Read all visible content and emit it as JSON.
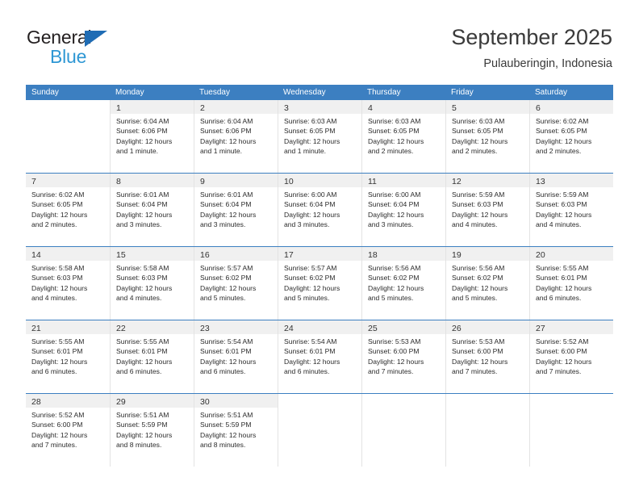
{
  "brand": {
    "name_part1": "General",
    "name_part2": "Blue",
    "triangle_icon": "brand-triangle-icon",
    "color_dark": "#231f20",
    "color_blue": "#2e97d4",
    "color_triangle": "#1f6cb4"
  },
  "header": {
    "title": "September 2025",
    "subtitle": "Pulauberingin, Indonesia"
  },
  "colors": {
    "header_row_bg": "#3c7fc1",
    "header_row_text": "#ffffff",
    "daynum_band_bg": "#f0f0f0",
    "cell_divider": "#e3e3e3",
    "week_divider": "#3c7fc1",
    "body_text": "#2b2b2b"
  },
  "weekdays": [
    "Sunday",
    "Monday",
    "Tuesday",
    "Wednesday",
    "Thursday",
    "Friday",
    "Saturday"
  ],
  "weeks": [
    [
      {
        "day": "",
        "lines": []
      },
      {
        "day": "1",
        "lines": [
          "Sunrise: 6:04 AM",
          "Sunset: 6:06 PM",
          "Daylight: 12 hours",
          "and 1 minute."
        ]
      },
      {
        "day": "2",
        "lines": [
          "Sunrise: 6:04 AM",
          "Sunset: 6:06 PM",
          "Daylight: 12 hours",
          "and 1 minute."
        ]
      },
      {
        "day": "3",
        "lines": [
          "Sunrise: 6:03 AM",
          "Sunset: 6:05 PM",
          "Daylight: 12 hours",
          "and 1 minute."
        ]
      },
      {
        "day": "4",
        "lines": [
          "Sunrise: 6:03 AM",
          "Sunset: 6:05 PM",
          "Daylight: 12 hours",
          "and 2 minutes."
        ]
      },
      {
        "day": "5",
        "lines": [
          "Sunrise: 6:03 AM",
          "Sunset: 6:05 PM",
          "Daylight: 12 hours",
          "and 2 minutes."
        ]
      },
      {
        "day": "6",
        "lines": [
          "Sunrise: 6:02 AM",
          "Sunset: 6:05 PM",
          "Daylight: 12 hours",
          "and 2 minutes."
        ]
      }
    ],
    [
      {
        "day": "7",
        "lines": [
          "Sunrise: 6:02 AM",
          "Sunset: 6:05 PM",
          "Daylight: 12 hours",
          "and 2 minutes."
        ]
      },
      {
        "day": "8",
        "lines": [
          "Sunrise: 6:01 AM",
          "Sunset: 6:04 PM",
          "Daylight: 12 hours",
          "and 3 minutes."
        ]
      },
      {
        "day": "9",
        "lines": [
          "Sunrise: 6:01 AM",
          "Sunset: 6:04 PM",
          "Daylight: 12 hours",
          "and 3 minutes."
        ]
      },
      {
        "day": "10",
        "lines": [
          "Sunrise: 6:00 AM",
          "Sunset: 6:04 PM",
          "Daylight: 12 hours",
          "and 3 minutes."
        ]
      },
      {
        "day": "11",
        "lines": [
          "Sunrise: 6:00 AM",
          "Sunset: 6:04 PM",
          "Daylight: 12 hours",
          "and 3 minutes."
        ]
      },
      {
        "day": "12",
        "lines": [
          "Sunrise: 5:59 AM",
          "Sunset: 6:03 PM",
          "Daylight: 12 hours",
          "and 4 minutes."
        ]
      },
      {
        "day": "13",
        "lines": [
          "Sunrise: 5:59 AM",
          "Sunset: 6:03 PM",
          "Daylight: 12 hours",
          "and 4 minutes."
        ]
      }
    ],
    [
      {
        "day": "14",
        "lines": [
          "Sunrise: 5:58 AM",
          "Sunset: 6:03 PM",
          "Daylight: 12 hours",
          "and 4 minutes."
        ]
      },
      {
        "day": "15",
        "lines": [
          "Sunrise: 5:58 AM",
          "Sunset: 6:03 PM",
          "Daylight: 12 hours",
          "and 4 minutes."
        ]
      },
      {
        "day": "16",
        "lines": [
          "Sunrise: 5:57 AM",
          "Sunset: 6:02 PM",
          "Daylight: 12 hours",
          "and 5 minutes."
        ]
      },
      {
        "day": "17",
        "lines": [
          "Sunrise: 5:57 AM",
          "Sunset: 6:02 PM",
          "Daylight: 12 hours",
          "and 5 minutes."
        ]
      },
      {
        "day": "18",
        "lines": [
          "Sunrise: 5:56 AM",
          "Sunset: 6:02 PM",
          "Daylight: 12 hours",
          "and 5 minutes."
        ]
      },
      {
        "day": "19",
        "lines": [
          "Sunrise: 5:56 AM",
          "Sunset: 6:02 PM",
          "Daylight: 12 hours",
          "and 5 minutes."
        ]
      },
      {
        "day": "20",
        "lines": [
          "Sunrise: 5:55 AM",
          "Sunset: 6:01 PM",
          "Daylight: 12 hours",
          "and 6 minutes."
        ]
      }
    ],
    [
      {
        "day": "21",
        "lines": [
          "Sunrise: 5:55 AM",
          "Sunset: 6:01 PM",
          "Daylight: 12 hours",
          "and 6 minutes."
        ]
      },
      {
        "day": "22",
        "lines": [
          "Sunrise: 5:55 AM",
          "Sunset: 6:01 PM",
          "Daylight: 12 hours",
          "and 6 minutes."
        ]
      },
      {
        "day": "23",
        "lines": [
          "Sunrise: 5:54 AM",
          "Sunset: 6:01 PM",
          "Daylight: 12 hours",
          "and 6 minutes."
        ]
      },
      {
        "day": "24",
        "lines": [
          "Sunrise: 5:54 AM",
          "Sunset: 6:01 PM",
          "Daylight: 12 hours",
          "and 6 minutes."
        ]
      },
      {
        "day": "25",
        "lines": [
          "Sunrise: 5:53 AM",
          "Sunset: 6:00 PM",
          "Daylight: 12 hours",
          "and 7 minutes."
        ]
      },
      {
        "day": "26",
        "lines": [
          "Sunrise: 5:53 AM",
          "Sunset: 6:00 PM",
          "Daylight: 12 hours",
          "and 7 minutes."
        ]
      },
      {
        "day": "27",
        "lines": [
          "Sunrise: 5:52 AM",
          "Sunset: 6:00 PM",
          "Daylight: 12 hours",
          "and 7 minutes."
        ]
      }
    ],
    [
      {
        "day": "28",
        "lines": [
          "Sunrise: 5:52 AM",
          "Sunset: 6:00 PM",
          "Daylight: 12 hours",
          "and 7 minutes."
        ]
      },
      {
        "day": "29",
        "lines": [
          "Sunrise: 5:51 AM",
          "Sunset: 5:59 PM",
          "Daylight: 12 hours",
          "and 8 minutes."
        ]
      },
      {
        "day": "30",
        "lines": [
          "Sunrise: 5:51 AM",
          "Sunset: 5:59 PM",
          "Daylight: 12 hours",
          "and 8 minutes."
        ]
      },
      {
        "day": "",
        "lines": []
      },
      {
        "day": "",
        "lines": []
      },
      {
        "day": "",
        "lines": []
      },
      {
        "day": "",
        "lines": []
      }
    ]
  ]
}
